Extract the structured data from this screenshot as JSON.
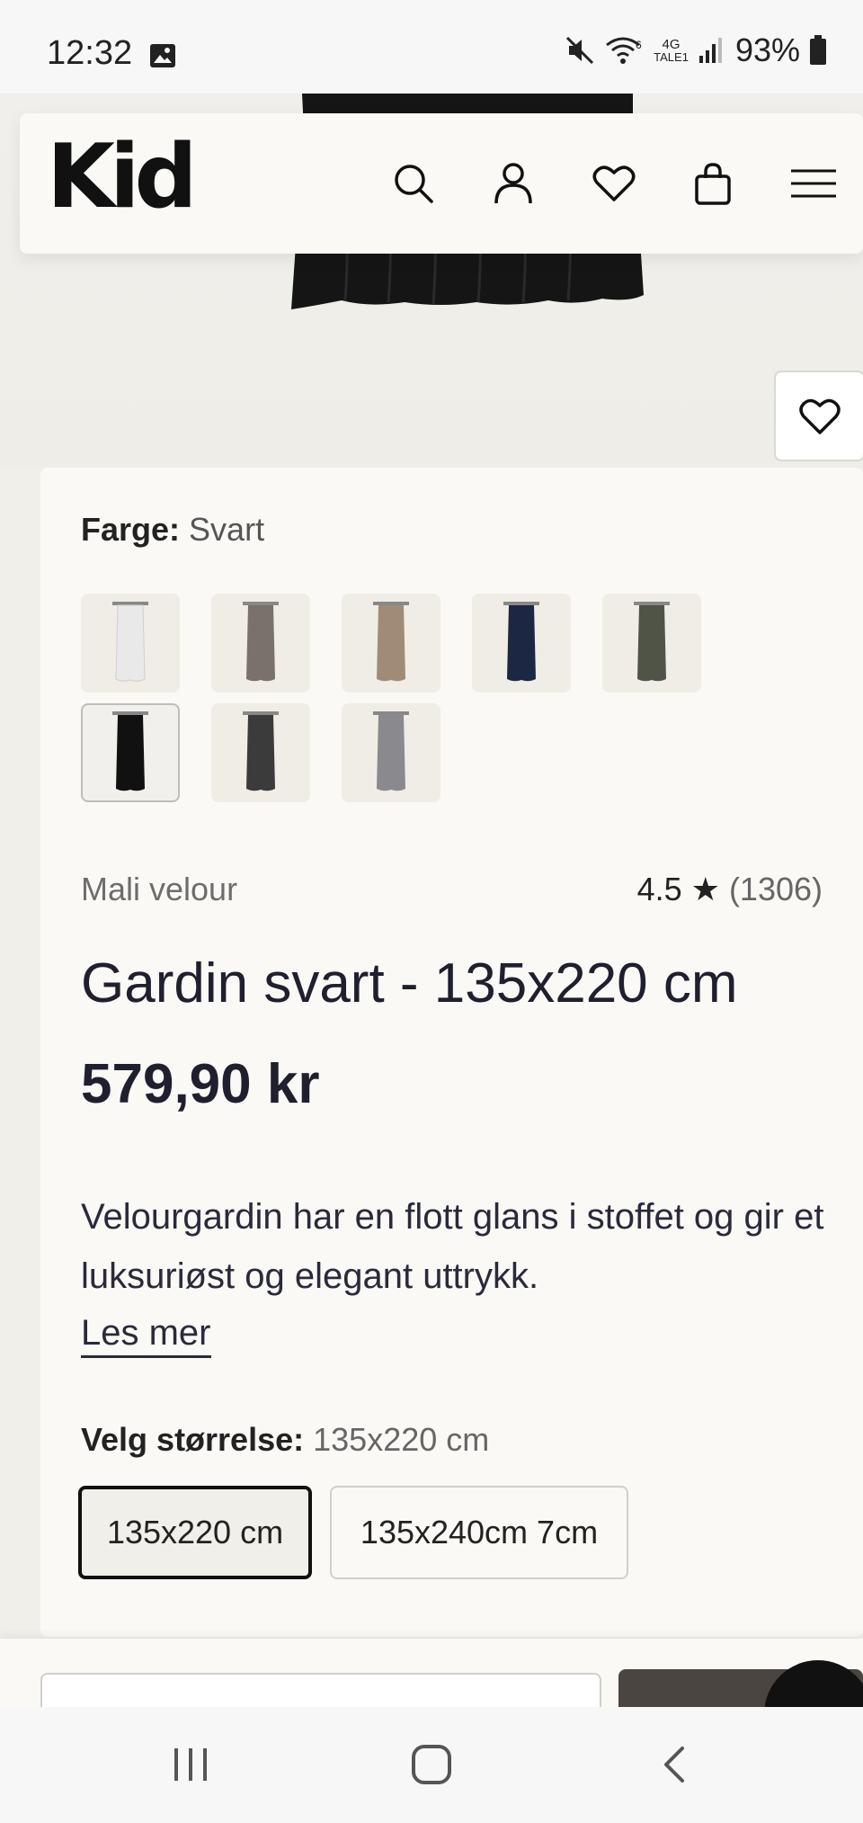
{
  "status_bar": {
    "time": "12:32",
    "battery": "93%",
    "network_top": "4G",
    "network_bottom": "TALE1",
    "icons": [
      "gallery-icon",
      "mute-icon",
      "wifi-icon",
      "signal-icon",
      "battery-icon"
    ]
  },
  "header": {
    "logo": "Kid",
    "icons": [
      "search-icon",
      "account-icon",
      "wishlist-icon",
      "cart-icon",
      "menu-icon"
    ]
  },
  "product": {
    "color_label": "Farge:",
    "color_value": "Svart",
    "swatches": [
      {
        "name": "white",
        "color": "#e9e9e9"
      },
      {
        "name": "taupe",
        "color": "#7a716b"
      },
      {
        "name": "beige",
        "color": "#a08c76"
      },
      {
        "name": "navy",
        "color": "#1c2744"
      },
      {
        "name": "olive",
        "color": "#505447"
      },
      {
        "name": "black",
        "color": "#111111",
        "selected": true
      },
      {
        "name": "dark-grey",
        "color": "#3b3b3b"
      },
      {
        "name": "grey",
        "color": "#8a8a8e"
      }
    ],
    "brand": "Mali velour",
    "rating_value": "4.5",
    "rating_star": "★",
    "rating_count": "(1306)",
    "title": "Gardin svart - 135x220 cm",
    "price": "579,90 kr",
    "description": "Velourgardin har en flott glans i stoffet og gir et luksuriøst og elegant uttrykk.",
    "read_more": "Les mer",
    "size_label": "Velg størrelse:",
    "size_value": "135x220 cm",
    "sizes": [
      {
        "label": "135x220 cm",
        "selected": true
      },
      {
        "label": "135x240cm 7cm",
        "selected": false
      }
    ]
  },
  "colors": {
    "background": "#f1efea",
    "card": "#faf9f6",
    "text": "#1f1f2e",
    "buy_button": "#4a4540"
  }
}
